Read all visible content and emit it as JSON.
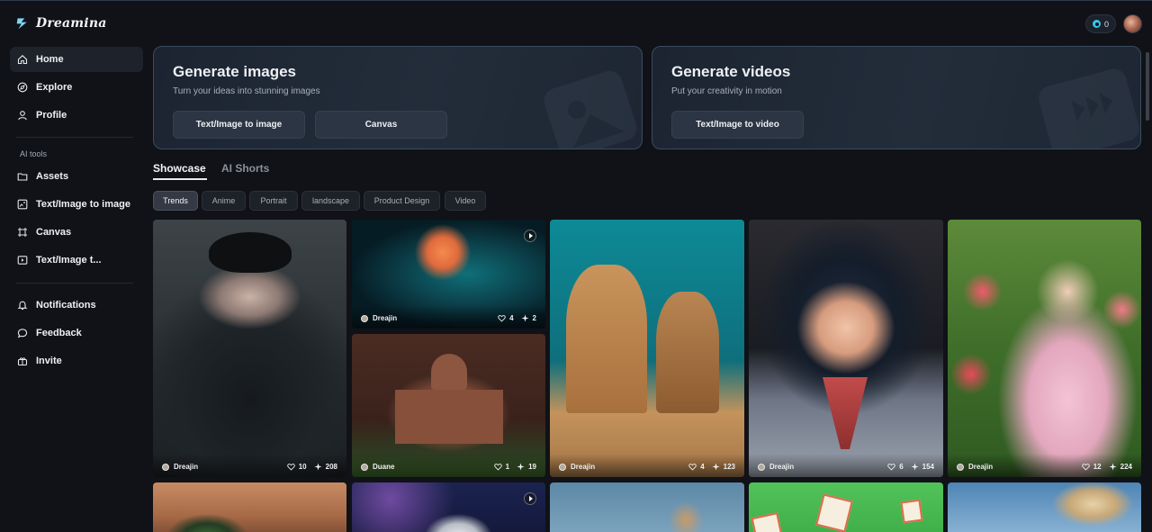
{
  "app": {
    "name": "Dreamina"
  },
  "header": {
    "credits": "0",
    "colors": {
      "accent": "#36c6e8"
    }
  },
  "sidebar": {
    "items": [
      {
        "label": "Home",
        "icon": "home-icon",
        "active": true
      },
      {
        "label": "Explore",
        "icon": "compass-icon"
      },
      {
        "label": "Profile",
        "icon": "user-icon"
      }
    ],
    "section_label": "AI tools",
    "tools": [
      {
        "label": "Assets",
        "icon": "folder-icon"
      },
      {
        "label": "Text/Image to image",
        "icon": "image-edit-icon"
      },
      {
        "label": "Canvas",
        "icon": "canvas-icon"
      },
      {
        "label": "Text/Image t...",
        "icon": "video-edit-icon"
      }
    ],
    "bottom": [
      {
        "label": "Notifications",
        "icon": "bell-icon"
      },
      {
        "label": "Feedback",
        "icon": "chat-icon"
      },
      {
        "label": "Invite",
        "icon": "gift-icon"
      }
    ]
  },
  "hero_images": {
    "title": "Generate images",
    "subtitle": "Turn your ideas into stunning images",
    "buttons": [
      "Text/Image to image",
      "Canvas"
    ]
  },
  "hero_videos": {
    "title": "Generate videos",
    "subtitle": "Put your creativity in motion",
    "buttons": [
      "Text/Image to video"
    ]
  },
  "tabs": [
    "Showcase",
    "AI Shorts"
  ],
  "filters": [
    "Trends",
    "Anime",
    "Portrait",
    "landscape",
    "Product Design",
    "Video"
  ],
  "cards": [
    {
      "user": "Dreajin",
      "likes": "10",
      "remixes": "208",
      "subject": "gothic girl in black lace dress"
    },
    {
      "user": "Dreajin",
      "likes": "4",
      "remixes": "2",
      "subject": "glowing orange rose",
      "video": true
    },
    {
      "user": "Duane",
      "likes": "1",
      "remixes": "19",
      "subject": "chocolate palace"
    },
    {
      "user": "Dreajin",
      "likes": "4",
      "remixes": "123",
      "subject": "sand castle and sand demon"
    },
    {
      "user": "Dreajin",
      "likes": "6",
      "remixes": "154",
      "subject": "anime girl in fur hood"
    },
    {
      "user": "Dreajin",
      "likes": "12",
      "remixes": "224",
      "subject": "girl among tulips"
    }
  ]
}
